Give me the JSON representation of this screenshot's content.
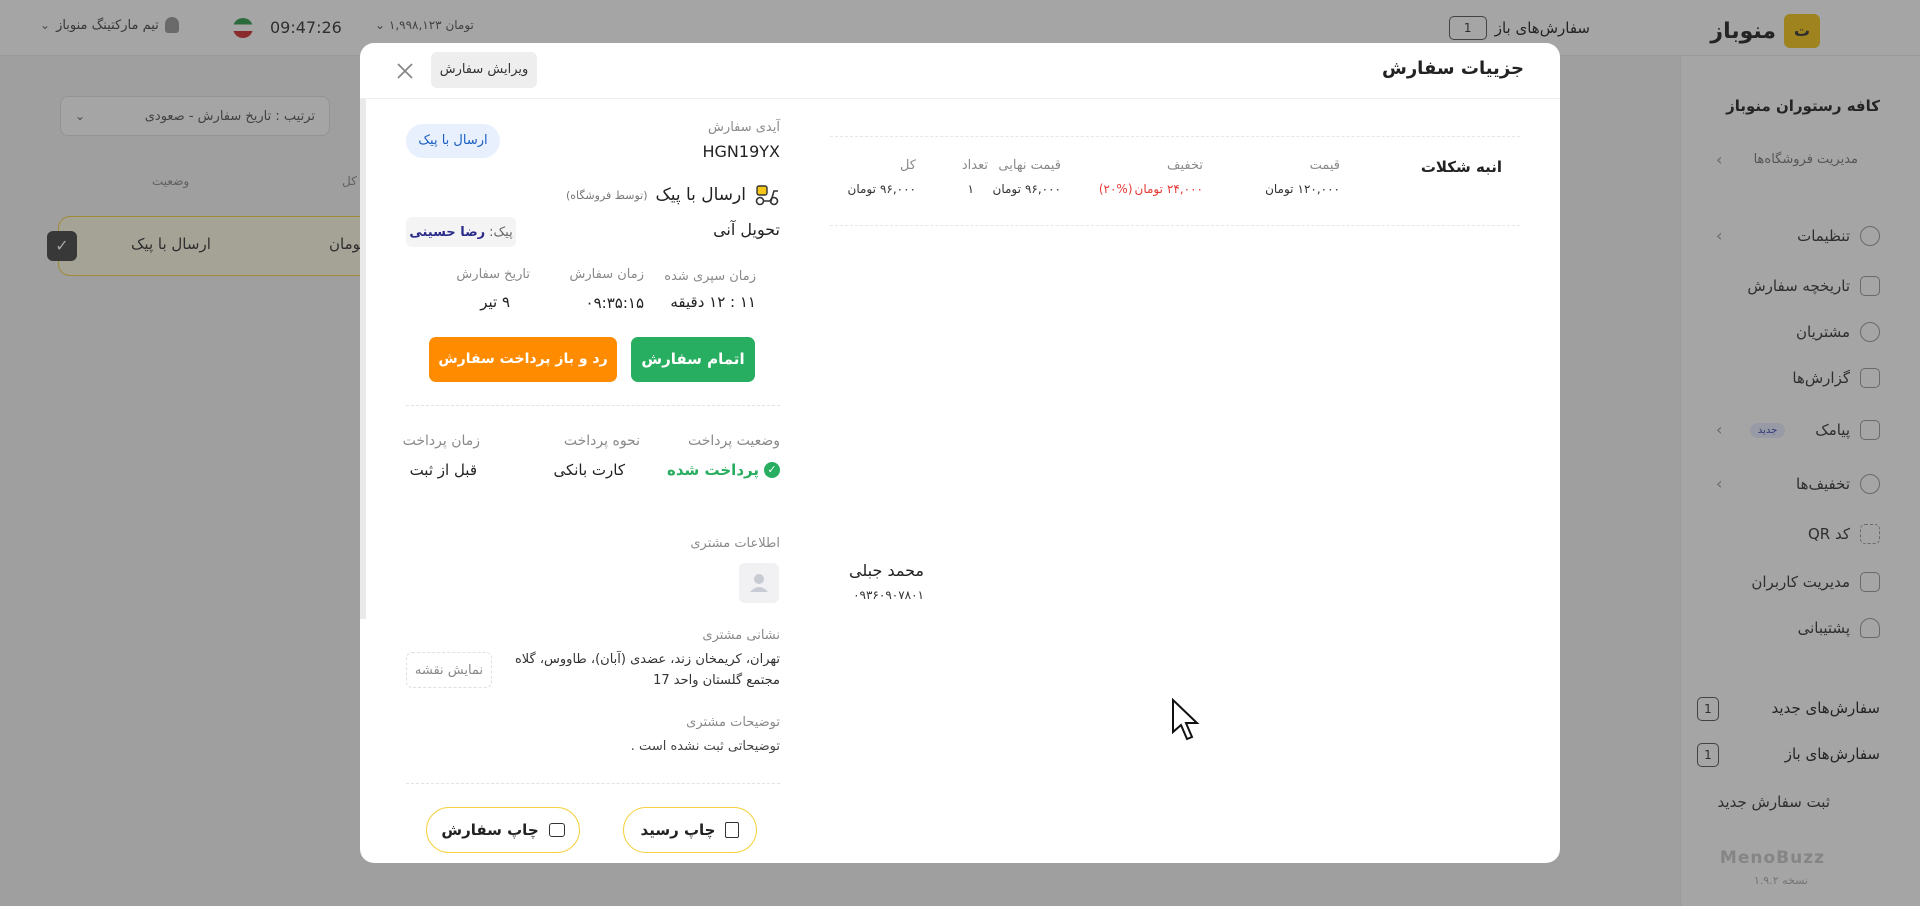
{
  "app": {
    "brand": "منوباز",
    "brand_letter": "ت",
    "restaurant": "کافه رستوران منوباز",
    "footer_brand": "MenoBuzz",
    "version": "نسخه ۱.۹.۲",
    "top": {
      "open_orders_label": "سفارش‌های باز",
      "open_orders_count": "1",
      "balance": "۱,۹۹۸,۱۲۳ تومان",
      "clock": "09:47:26",
      "team": "تیم مارکتینگ منوباز"
    },
    "sidebar": {
      "store_mgmt": "مدیریت فروشگاه‌ها",
      "items": [
        {
          "label": "تنظیمات",
          "icon": "gear-icon"
        },
        {
          "label": "تاریخچه سفارش",
          "icon": "history-icon"
        },
        {
          "label": "مشتریان",
          "icon": "users-icon"
        },
        {
          "label": "گزارش‌ها",
          "icon": "chart-icon"
        },
        {
          "label": "پیامک",
          "icon": "message-icon"
        },
        {
          "label": "تخفیف‌ها",
          "icon": "discount-icon"
        },
        {
          "label": "کد QR",
          "icon": "qr-icon"
        },
        {
          "label": "مدیریت کاربران",
          "icon": "user-manage-icon"
        },
        {
          "label": "پشتیبانی",
          "icon": "headset-icon"
        }
      ],
      "new_badge": "جدید",
      "new_orders": "سفارش‌های جدید",
      "new_orders_count": "1",
      "open_orders": "سفارش‌های باز",
      "open_orders_count": "1",
      "register_order": "ثبت سفارش جدید"
    },
    "main": {
      "sort_label": "ترتیب : تاریخ سفارش - صعودی",
      "col_status": "وضعیت",
      "col_total": "کل",
      "row_status": "ارسال با پیک",
      "row_total": "تومان"
    }
  },
  "modal": {
    "title": "جزییات سفارش",
    "edit_button": "ویرایش سفارش",
    "items_table": {
      "headers": {
        "price": "قیمت",
        "discount": "تخفیف",
        "final": "قیمت نهایی",
        "qty": "تعداد",
        "total": "کل"
      },
      "rows": [
        {
          "name": "انبه شکلات",
          "price": "۱۲۰,۰۰۰",
          "price_unit": "تومان",
          "discount": "۲۴,۰۰۰",
          "discount_unit": "تومان",
          "discount_pct": "(۲۰%)",
          "final": "۹۶,۰۰۰",
          "final_unit": "تومان",
          "qty": "۱",
          "total": "۹۶,۰۰۰",
          "total_unit": "تومان"
        }
      ]
    },
    "order": {
      "id_label": "آیدی سفارش",
      "id": "HGN19YX",
      "delivery_badge": "ارسال با پیک",
      "delivery_type": "ارسال با پیک",
      "delivery_note": "(توسط فروشگاه)",
      "delivery_time": "تحویل آنی",
      "courier_label": "پیک:",
      "courier_name": "رضا حسینی",
      "elapsed_label": "زمان سپری شده",
      "elapsed": "۱۱ : ۱۲ دقیقه",
      "time_label": "زمان سفارش",
      "time": "۰۹:۳۵:۱۵",
      "date_label": "تاریخ سفارش",
      "date": "۹ تیر",
      "complete_button": "اتمام سفارش",
      "reject_button": "رد و باز پرداخت سفارش"
    },
    "payment": {
      "status_label": "وضعیت پرداخت",
      "status": "پرداخت شده",
      "method_label": "نحوه پرداخت",
      "method": "کارت بانکی",
      "time_label": "زمان پرداخت",
      "time": "قبل از ثبت"
    },
    "customer": {
      "info_label": "اطلاعات مشتری",
      "name": "محمد جبلی",
      "phone": "۰۹۳۶۰۹۰۷۸۰۱",
      "address_label": "نشانی مشتری",
      "address_line1": "تهران، کریمخان زند، عضدی (آبان)، طاووس، گلاه",
      "address_line2": "مجتمع گلستان واحد 17",
      "map_button": "نمایش نقشه",
      "notes_label": "توضیحات مشتری",
      "notes": "توضیحاتی ثبت نشده است ."
    },
    "print_receipt": "چاپ رسید",
    "print_order": "چاپ سفارش"
  },
  "colors": {
    "brand_yellow": "#f5c518",
    "green": "#27ae60",
    "orange": "#ff8c00",
    "discount_red": "#e53935",
    "badge_blue": "#e8f0fe"
  }
}
